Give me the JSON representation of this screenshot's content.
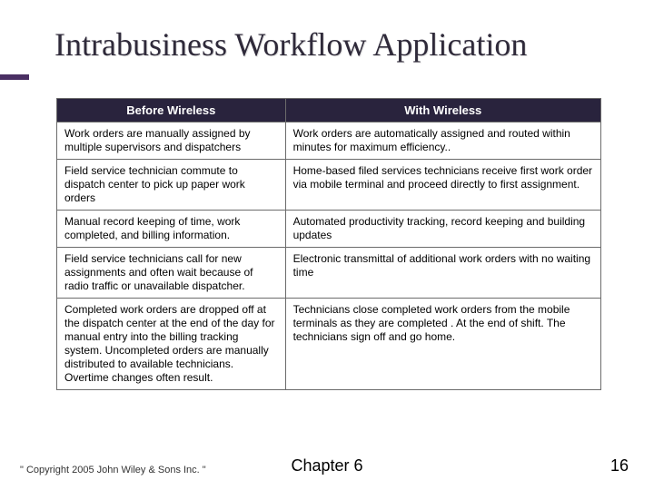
{
  "title": "Intrabusiness Workflow Application",
  "table": {
    "headers": {
      "left": "Before Wireless",
      "right": "With Wireless"
    },
    "rows": [
      {
        "left": "Work orders are manually assigned by multiple supervisors and dispatchers",
        "right": "Work orders are automatically assigned and routed within minutes for maximum efficiency.."
      },
      {
        "left": "Field service technician commute to dispatch center to pick up  paper work orders",
        "right": "Home-based filed services technicians receive first work order via mobile terminal and proceed directly to first assignment."
      },
      {
        "left": "Manual record keeping of time, work completed, and billing information.",
        "right": "Automated productivity tracking, record keeping and building updates"
      },
      {
        "left": "Field service technicians call for new assignments and often wait because of radio traffic or unavailable dispatcher.",
        "right": "Electronic transmittal of additional work orders with no waiting time"
      },
      {
        "left": "Completed work orders are dropped off at the dispatch center at the end of the day for manual entry into the billing tracking system. Uncompleted orders are manually distributed to available technicians. Overtime changes often result.",
        "right": "Technicians close completed work orders from the mobile terminals as they are completed . At the end of shift. The technicians sign off and go home."
      }
    ]
  },
  "footer": {
    "copyright": "\" Copyright 2005 John Wiley & Sons Inc. \"",
    "chapter": "Chapter 6",
    "page": "16"
  }
}
